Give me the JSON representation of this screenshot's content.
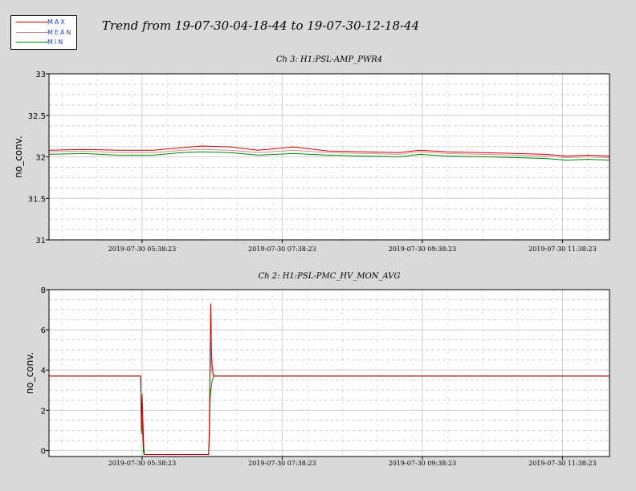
{
  "title": "Trend from 19-07-30-04-18-44 to 19-07-30-12-18-44",
  "legend": [
    {
      "label": "MAX",
      "color": "#cc0000"
    },
    {
      "label": "MEAN",
      "color": "#d09090"
    },
    {
      "label": "MIN",
      "color": "#008800"
    }
  ],
  "chart_data": [
    {
      "type": "line",
      "title": "Ch 3: H1:PSL-AMP_PWR4",
      "ylabel": "no_conv.",
      "ylim": [
        31,
        33
      ],
      "yticks": [
        "31",
        "31.5",
        "32",
        "32.5",
        "33"
      ],
      "xticks": [
        "2019-07-30 05:38:23",
        "2019-07-30 07:38:23",
        "2019-07-30 09:38:23",
        "2019-07-30 11:38:23"
      ],
      "xlim_hours": [
        4.311,
        12.311
      ],
      "x_hours": [
        4.311,
        4.8,
        5.3,
        5.8,
        6.2,
        6.5,
        6.9,
        7.3,
        7.8,
        8.3,
        8.8,
        9.3,
        9.6,
        10.0,
        10.5,
        11.0,
        11.4,
        11.7,
        12.0,
        12.311
      ],
      "series": [
        {
          "name": "MAX",
          "values": [
            32.08,
            32.09,
            32.08,
            32.08,
            32.11,
            32.13,
            32.12,
            32.08,
            32.12,
            32.07,
            32.06,
            32.05,
            32.08,
            32.06,
            32.05,
            32.04,
            32.03,
            32.01,
            32.02,
            32.01
          ]
        },
        {
          "name": "MEAN",
          "values": [
            32.06,
            32.07,
            32.05,
            32.05,
            32.08,
            32.09,
            32.08,
            32.05,
            32.08,
            32.05,
            32.04,
            32.03,
            32.06,
            32.04,
            32.03,
            32.02,
            32.01,
            31.99,
            32.0,
            31.99
          ]
        },
        {
          "name": "MIN",
          "values": [
            32.03,
            32.04,
            32.02,
            32.02,
            32.05,
            32.06,
            32.05,
            32.02,
            32.04,
            32.02,
            32.01,
            32.0,
            32.03,
            32.01,
            32.0,
            31.99,
            31.98,
            31.96,
            31.97,
            31.96
          ]
        }
      ]
    },
    {
      "type": "line",
      "title": "Ch 2: H1:PSL-PMC_HV_MON_AVG",
      "ylabel": "no_conv.",
      "ylim": [
        -0.3,
        8
      ],
      "yticks": [
        "0",
        "2",
        "4",
        "6",
        "8"
      ],
      "xticks": [
        "2019-07-30 05:38:23",
        "2019-07-30 07:38:23",
        "2019-07-30 09:38:23",
        "2019-07-30 11:38:23"
      ],
      "xlim_hours": [
        4.311,
        12.311
      ],
      "x_hours": [
        4.311,
        5.62,
        5.63,
        5.64,
        5.66,
        5.67,
        5.69,
        6.59,
        6.6,
        6.61,
        6.62,
        6.63,
        6.64,
        6.65,
        6.67,
        12.311
      ],
      "series": [
        {
          "name": "MAX",
          "values": [
            3.7,
            3.7,
            1.0,
            2.8,
            0.5,
            -0.2,
            -0.2,
            -0.2,
            1.0,
            4.8,
            7.3,
            5.0,
            4.2,
            3.9,
            3.7,
            3.7
          ]
        },
        {
          "name": "MEAN",
          "values": [
            3.7,
            3.7,
            1.5,
            2.0,
            0.2,
            -0.2,
            -0.2,
            -0.2,
            0.8,
            3.5,
            5.5,
            4.0,
            3.8,
            3.7,
            3.7,
            3.7
          ]
        },
        {
          "name": "MIN",
          "values": [
            3.7,
            3.7,
            0.8,
            1.5,
            -0.1,
            -0.2,
            -0.2,
            -0.2,
            0.6,
            2.5,
            3.0,
            3.2,
            3.5,
            3.6,
            3.7,
            3.7
          ]
        }
      ]
    }
  ]
}
